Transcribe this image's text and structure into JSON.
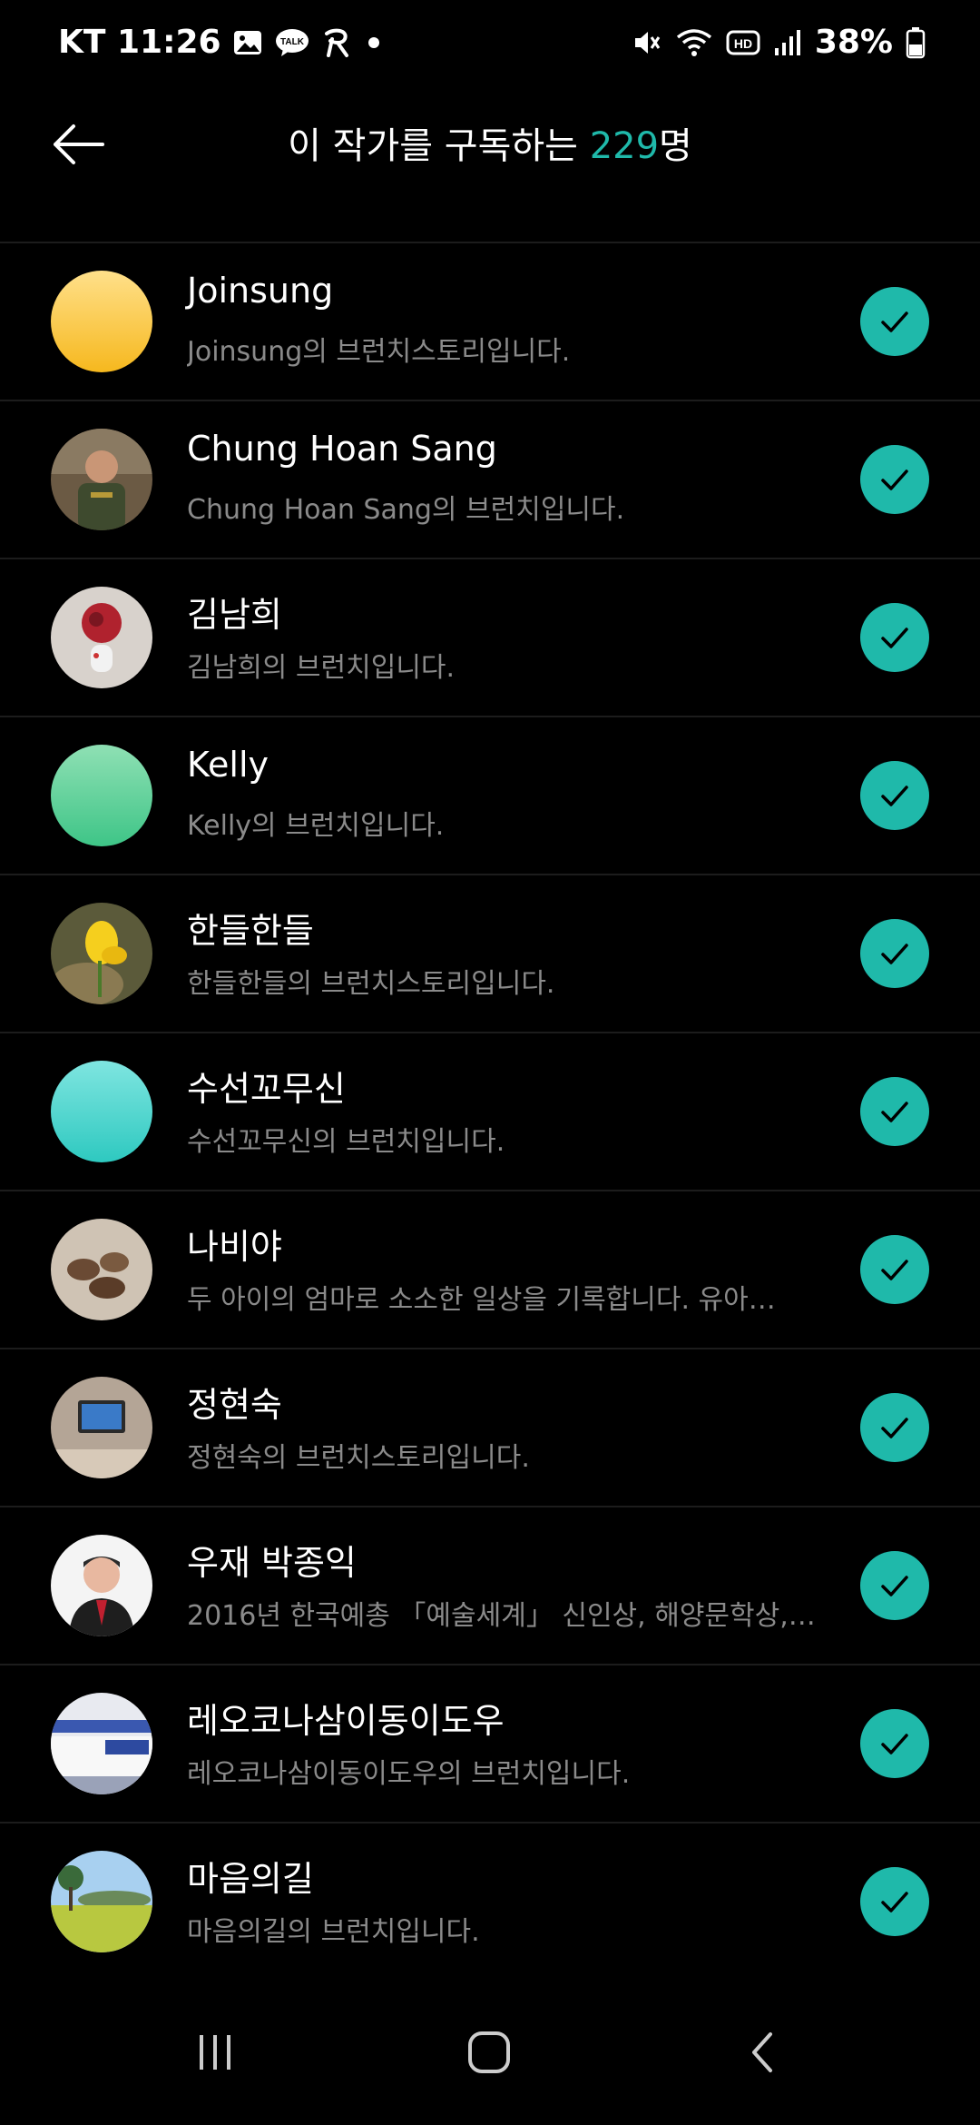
{
  "status_bar": {
    "carrier_time": "KT 11:26",
    "battery_percent": "38%",
    "icons": [
      "gallery-icon",
      "kakaotalk-icon",
      "app-icon",
      "dot-icon",
      "mute-icon",
      "wifi-icon",
      "hd-icon",
      "signal-icon",
      "battery-icon"
    ]
  },
  "header": {
    "title_prefix": "이 작가를 구독하는 ",
    "count": "229",
    "title_suffix": "명"
  },
  "subscribers": [
    {
      "name": "Joinsung",
      "desc": "Joinsung의 브런치스토리입니다.",
      "subscribed": true
    },
    {
      "name": "Chung Hoan Sang",
      "desc": "Chung Hoan Sang의 브런치입니다.",
      "subscribed": true
    },
    {
      "name": "김남희",
      "desc": "김남희의 브런치입니다.",
      "subscribed": true
    },
    {
      "name": "Kelly",
      "desc": "Kelly의 브런치입니다.",
      "subscribed": true
    },
    {
      "name": "한들한들",
      "desc": "한들한들의 브런치스토리입니다.",
      "subscribed": true
    },
    {
      "name": "수선꼬무신",
      "desc": "수선꼬무신의 브런치입니다.",
      "subscribed": true
    },
    {
      "name": "나비야",
      "desc": "두 아이의 엄마로 소소한 일상을 기록합니다. 유아…",
      "subscribed": true
    },
    {
      "name": "정현숙",
      "desc": "정현숙의 브런치스토리입니다.",
      "subscribed": true
    },
    {
      "name": "우재 박종익",
      "desc": "2016년 한국예총 「예술세계」 신인상, 해양문학상, …",
      "subscribed": true
    },
    {
      "name": "레오코나삼이동이도우",
      "desc": "레오코나삼이동이도우의 브런치입니다.",
      "subscribed": true
    },
    {
      "name": "마음의길",
      "desc": "마음의길의 브런치입니다.",
      "subscribed": true
    }
  ],
  "colors": {
    "accent": "#1fb9aa",
    "background": "#000000",
    "secondary_text": "#8a8a8a"
  }
}
